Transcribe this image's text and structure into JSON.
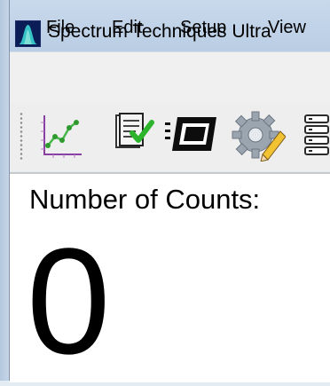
{
  "window": {
    "title": "Spectrum Techniques Ultra",
    "icon": "spectrum-app-icon"
  },
  "menu": {
    "items": [
      "File",
      "Edit",
      "Setup",
      "View"
    ]
  },
  "toolbar": {
    "buttons": [
      "chart-icon",
      "checklist-icon",
      "device-icon",
      "gear-pencil-icon",
      "list-icon"
    ]
  },
  "counts": {
    "label": "Number of Counts:",
    "value": "0"
  }
}
